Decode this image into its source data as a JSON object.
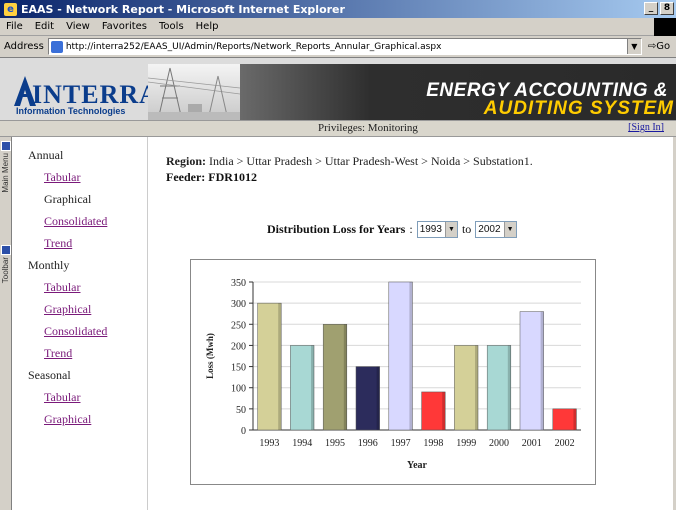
{
  "window": {
    "title": "EAAS - Network Report - Microsoft Internet Explorer",
    "buttons": [
      "_",
      "8",
      ""
    ]
  },
  "menu": [
    "File",
    "Edit",
    "View",
    "Favorites",
    "Tools",
    "Help"
  ],
  "address": {
    "label": "Address",
    "url": "http://interra252/EAAS_UI/Admin/Reports/Network_Reports_Annular_Graphical.aspx",
    "go": "Go"
  },
  "banner": {
    "logo": "INTERRA",
    "logo_sub": "Information Technologies",
    "title_line1": "ENERGY  ACCOUNTING &",
    "title_line2": "AUDITING  SYSTEM"
  },
  "privileges": {
    "text": "Privileges: Monitoring",
    "signin": "[Sign In]"
  },
  "side_tabs": [
    "Main Menu",
    "Toolbar"
  ],
  "nav": {
    "annual": "Annual",
    "annual_items": [
      "Tabular",
      "Graphical",
      "Consolidated",
      "Trend"
    ],
    "monthly": "Monthly",
    "monthly_items": [
      "Tabular",
      "Graphical",
      "Consolidated",
      "Trend"
    ],
    "seasonal": "Seasonal",
    "seasonal_items": [
      "Tabular",
      "Graphical"
    ]
  },
  "main": {
    "region_label": "Region:",
    "region_path": "India > Uttar Pradesh > Uttar Pradesh-West > Noida > Substation1.",
    "feeder": "Feeder: FDR1012",
    "dist_label": "Distribution Loss for Years",
    "dist_colon": ":",
    "from_year": "1993",
    "to_label": "to",
    "to_year": "2002"
  },
  "chart_data": {
    "type": "bar",
    "categories": [
      "1993",
      "1994",
      "1995",
      "1996",
      "1997",
      "1998",
      "1999",
      "2000",
      "2001",
      "2002"
    ],
    "values": [
      300,
      200,
      250,
      150,
      350,
      90,
      200,
      200,
      280,
      50
    ],
    "colors": [
      "#d4d098",
      "#a8d8d4",
      "#a0a070",
      "#2c2c5c",
      "#d8d8ff",
      "#ff3838",
      "#d4d098",
      "#a8d8d4",
      "#d8d8ff",
      "#ff3838"
    ],
    "ylabel": "Loss (Mwh)",
    "xlabel": "Year",
    "ylim": [
      0,
      350
    ],
    "yticks": [
      0,
      50,
      100,
      150,
      200,
      250,
      300,
      350
    ],
    "grid": true
  }
}
